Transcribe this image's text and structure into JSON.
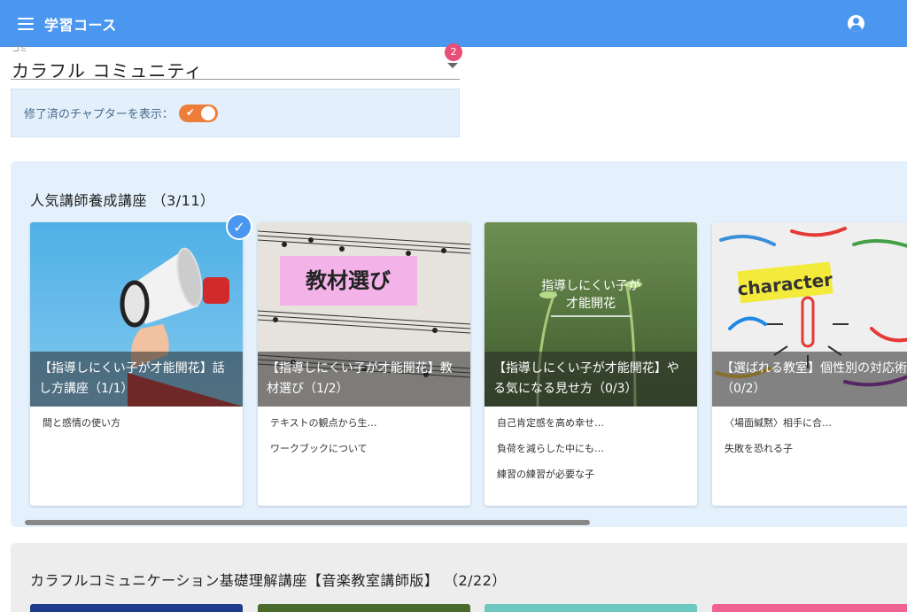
{
  "app": {
    "title": "学習コース"
  },
  "community_select": {
    "label": "コミ",
    "value": "カラフル コミュニティ",
    "badge": "2"
  },
  "toggle": {
    "label": "修了済のチャプターを表示：",
    "checked": true
  },
  "sections": [
    {
      "title": "人気講師養成講座 （3/11）",
      "cards": [
        {
          "title": "【指導しにくい子が才能開花】話し方講座（1/1）",
          "completed": true,
          "lessons": [
            "間と感情の使い方"
          ]
        },
        {
          "title": "【指導しにくい子が才能開花】教材選び（1/2）",
          "image_text": "教材選び",
          "lessons": [
            "テキストの観点から生…",
            "ワークブックについて"
          ]
        },
        {
          "title": "【指導しにくい子が才能開花】やる気になる見せ方（0/3）",
          "image_text": "指導しにくい子が\n才能開花",
          "lessons": [
            "自己肯定感を高め幸せ…",
            "負荷を減らした中にも…",
            "練習の練習が必要な子"
          ]
        },
        {
          "title": "【選ばれる教室】個性別の対応術（0/2）",
          "image_text": "character",
          "lessons": [
            "〈場面緘黙〉相手に合…",
            "失敗を恐れる子"
          ]
        }
      ]
    },
    {
      "title": "カラフルコミュニケーション基礎理解講座【音楽教室講師版】 （2/22）"
    }
  ],
  "colors": {
    "app_bar": "#4b97f0",
    "toggle": "#ef7d3a",
    "badge": "#e94e77",
    "section_bg": "#e4f1fd"
  }
}
